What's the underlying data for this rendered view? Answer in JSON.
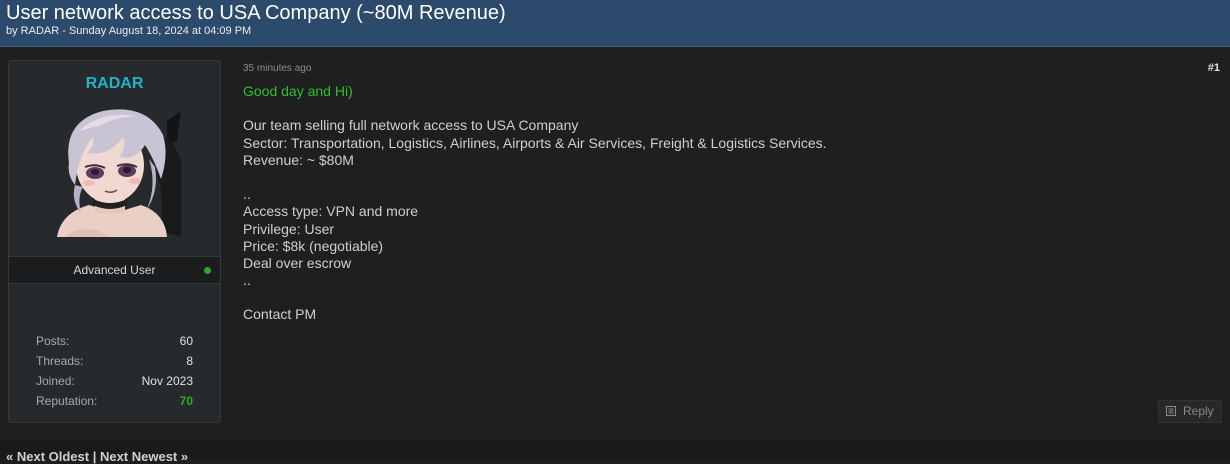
{
  "thread": {
    "title": "User network access to USA Company (~80M Revenue)",
    "byline": "by RADAR - Sunday August 18, 2024 at 04:09 PM"
  },
  "author": {
    "username": "RADAR",
    "user_title": "Advanced User",
    "online": true,
    "avatar_icon": "anime-avatar",
    "stats": [
      {
        "label": "Posts:",
        "value": "60"
      },
      {
        "label": "Threads:",
        "value": "8"
      },
      {
        "label": "Joined:",
        "value": "Nov 2023"
      },
      {
        "label": "Reputation:",
        "value": "70"
      }
    ]
  },
  "post": {
    "time": "35 minutes ago",
    "number": "#1",
    "lines": [
      "Good day and Hi)",
      "",
      "Our team selling full network access to USA Company",
      "Sector: Transportation, Logistics, Airlines, Airports & Air Services, Freight & Logistics Services.",
      "Revenue: ~ $80M",
      "",
      "..",
      "Access type: VPN and more",
      "Privilege: User",
      "Price: $8k (negotiable)",
      "Deal over escrow",
      "..",
      "",
      "Contact PM"
    ]
  },
  "actions": {
    "reply_label": "Reply"
  },
  "nav": {
    "text": "« Next Oldest | Next Newest »"
  },
  "colors": {
    "header_bg": "#2c4a6b",
    "username": "#22b3c9",
    "greeting": "#2fbf2f",
    "reputation": "#2eaa2e",
    "online": "#2fa22f"
  }
}
